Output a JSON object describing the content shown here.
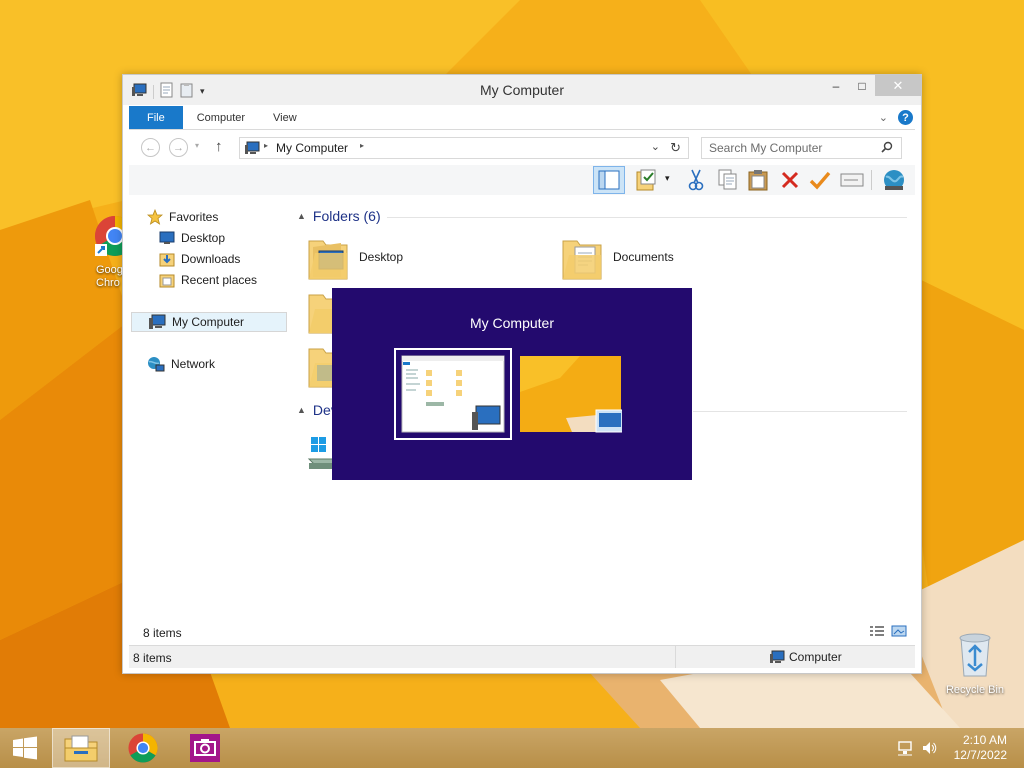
{
  "desktop": {
    "icons": [
      {
        "label": "Goog\nChro",
        "name": "google-chrome"
      },
      {
        "label": "Recycle Bin",
        "name": "recycle-bin"
      }
    ]
  },
  "window": {
    "title": "My Computer",
    "ribbon_tabs": [
      "File",
      "Computer",
      "View"
    ],
    "address": {
      "crumb": "My Computer"
    },
    "search": {
      "placeholder": "Search My Computer"
    },
    "nav_pane": {
      "favorites": "Favorites",
      "desktop": "Desktop",
      "downloads": "Downloads",
      "recent": "Recent places",
      "my_computer": "My Computer",
      "network": "Network"
    },
    "groups": {
      "folders_header": "Folders (6)",
      "devices_header": "Dev"
    },
    "folders": [
      {
        "label": "Desktop"
      },
      {
        "label": "Documents"
      }
    ],
    "item_count": "8 items",
    "statusbar": {
      "count": "8 items",
      "location": "Computer"
    }
  },
  "switcher": {
    "title": "My Computer",
    "thumbs": [
      "my-computer-window",
      "desktop"
    ],
    "selected_index": 0
  },
  "taskbar": {
    "apps": [
      "start",
      "file-explorer",
      "chrome",
      "camera"
    ],
    "time": "2:10 AM",
    "date": "12/7/2022"
  },
  "colors": {
    "accent": "#1979ca",
    "switcher_bg": "#230a6e",
    "wallpaper": "#f3a90f"
  }
}
